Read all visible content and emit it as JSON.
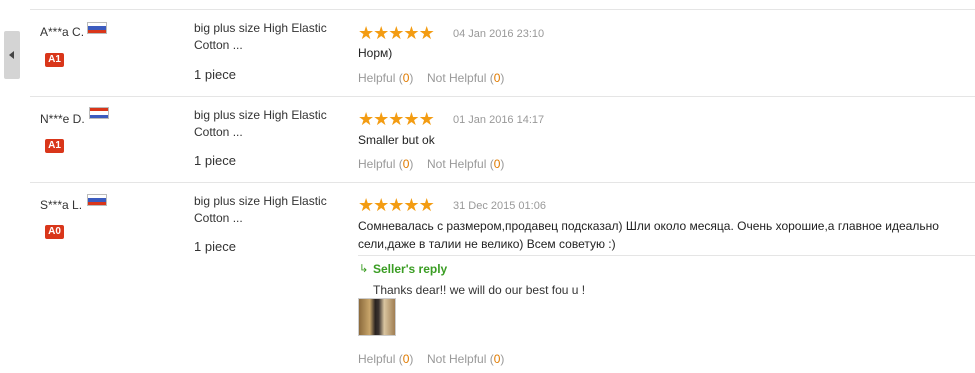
{
  "nav": {
    "collapse_icon": "chevron-left-icon"
  },
  "colors": {
    "accent_star": "#f39c12",
    "badge_red": "#d9361a",
    "reply_green": "#3a9d23",
    "count_orange": "#e07b00"
  },
  "reviews": [
    {
      "buyer": "A***a C.",
      "flag": "ru",
      "level": "A1",
      "product": "big plus size High Elastic Cotton ...",
      "quantity": "1 piece",
      "stars": 5,
      "date": "04 Jan 2016 23:10",
      "comment": "Норм)",
      "helpful_label": "Helpful",
      "helpful_count": "0",
      "not_helpful_label": "Not Helpful",
      "not_helpful_count": "0"
    },
    {
      "buyer": "N***e D.",
      "flag": "nl",
      "level": "A1",
      "product": "big plus size High Elastic Cotton ...",
      "quantity": "1 piece",
      "stars": 5,
      "date": "01 Jan 2016 14:17",
      "comment": "Smaller but ok",
      "helpful_label": "Helpful",
      "helpful_count": "0",
      "not_helpful_label": "Not Helpful",
      "not_helpful_count": "0"
    },
    {
      "buyer": "S***a L.",
      "flag": "ru",
      "level": "A0",
      "product": "big plus size High Elastic Cotton ...",
      "quantity": "1 piece",
      "stars": 5,
      "date": "31 Dec 2015 01:06",
      "comment": "Сомневалась с размером,продавец подсказал) Шли около месяца. Очень хорошие,а главное идеально сели,даже в талии не велико) Всем советую :)",
      "seller_reply_label": "Seller's reply",
      "seller_reply_icon": "reply-arrow-icon",
      "seller_reply_text": "Thanks dear!! we will do our best fou u !",
      "helpful_label": "Helpful",
      "helpful_count": "0",
      "not_helpful_label": "Not Helpful",
      "not_helpful_count": "0"
    }
  ]
}
